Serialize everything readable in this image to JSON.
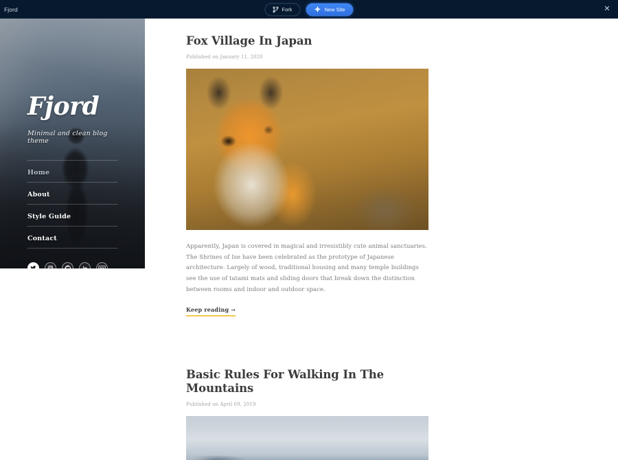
{
  "topbar": {
    "title": "Fjord",
    "fork_label": "Fork",
    "fork_icon": "fork-icon",
    "new_site_label": "New Site",
    "new_site_icon": "netlify-logo-icon",
    "close_icon": "close-icon",
    "close_glyph": "✕",
    "background_color": "#06192e",
    "accent_color": "#3f86f4"
  },
  "sidebar": {
    "logo": "Fjord",
    "tagline": "Minimal and clean blog theme",
    "nav": [
      {
        "label": "Home",
        "state": "muted"
      },
      {
        "label": "About",
        "state": "default"
      },
      {
        "label": "Style Guide",
        "state": "default"
      },
      {
        "label": "Contact",
        "state": "default"
      }
    ],
    "social": [
      {
        "name": "twitter-icon",
        "label": "Twitter"
      },
      {
        "name": "instagram-icon",
        "label": "Instagram"
      },
      {
        "name": "github-icon",
        "label": "GitHub"
      },
      {
        "name": "linkedin-icon",
        "label": "LinkedIn"
      },
      {
        "name": "dev-icon",
        "label": "DEV"
      }
    ],
    "background_image": "snowy-mountain-hiker-photo"
  },
  "posts": [
    {
      "title": "Fox Village In Japan",
      "date": "Published on January 11, 2020",
      "image": "red-fox-in-golden-grass-photo",
      "body": "Apparently, Japan is covered in magical and irresistibly cute animal sanctuaries. The Shrines of Ise have been celebrated as the prototype of Japanese architecture. Largely of wood, traditional housing and many temple buildings see the use of tatami mats and sliding doors that break down the distinction between rooms and indoor and outdoor space.",
      "read_more": "Keep reading",
      "read_more_arrow": "→"
    },
    {
      "title": "Basic Rules For Walking In The Mountains",
      "date": "Published on April 09, 2019",
      "image": "misty-fjord-mountain-photo"
    }
  ]
}
